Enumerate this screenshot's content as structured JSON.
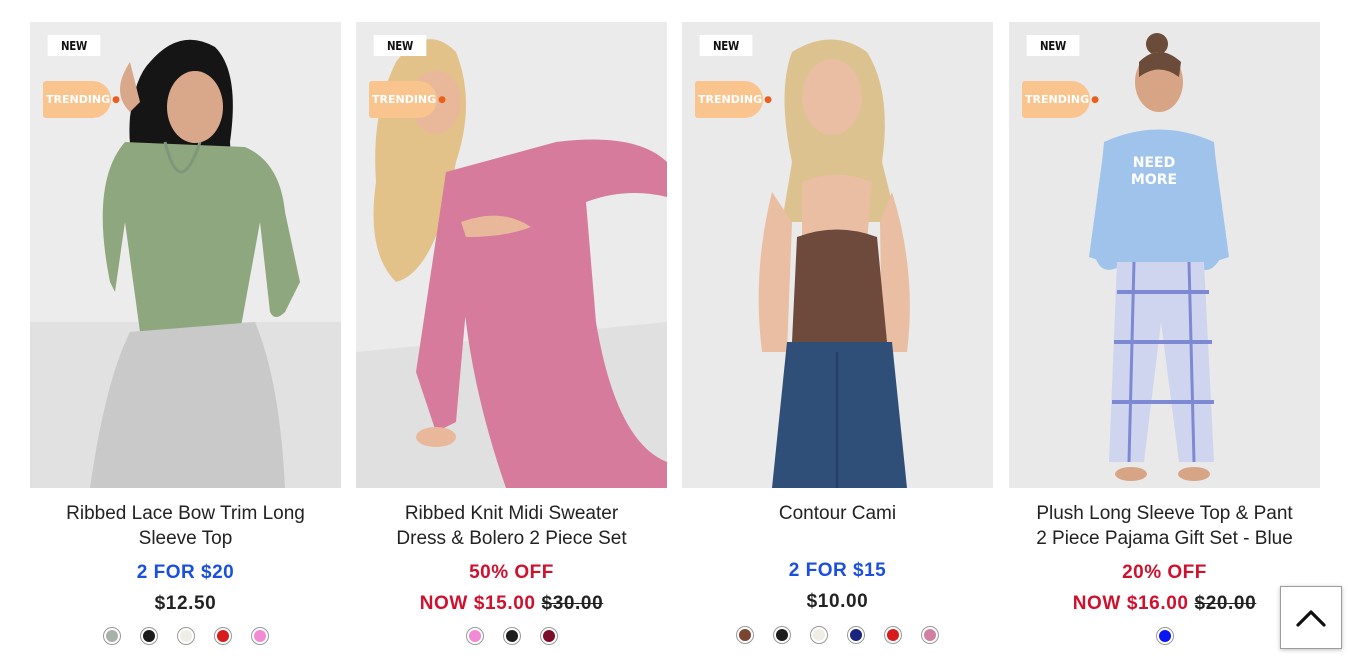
{
  "products": [
    {
      "badge_new": "NEW",
      "badge_trending": "TRENDING",
      "title_line1": "Ribbed Lace Bow Trim Long",
      "title_line2": "Sleeve Top",
      "promo": "2 FOR $20",
      "price": "$12.50",
      "swatches": [
        "#a7b3aa",
        "#1d1d1d",
        "#efeee6",
        "#d81b1b",
        "#f28ad6"
      ]
    },
    {
      "badge_new": "NEW",
      "badge_trending": "TRENDING",
      "title_line1": "Ribbed Knit Midi Sweater",
      "title_line2": "Dress & Bolero 2 Piece Set",
      "promo": "50% OFF",
      "price_now": "NOW $15.00",
      "price_was": "$30.00",
      "swatches": [
        "#f28ad6",
        "#1d1d1d",
        "#7d0e2b"
      ]
    },
    {
      "badge_new": "NEW",
      "badge_trending": "TRENDING",
      "title_line1": "Contour Cami",
      "title_line2": "",
      "promo": "2 FOR $15",
      "price": "$10.00",
      "swatches": [
        "#7a4631",
        "#1d1d1d",
        "#efeee6",
        "#1b2380",
        "#d81b1b",
        "#d17fa3"
      ]
    },
    {
      "badge_new": "NEW",
      "badge_trending": "TRENDING",
      "title_line1": "Plush Long Sleeve Top & Pant",
      "title_line2": "2 Piece Pajama Gift Set - Blue",
      "promo": "20% OFF",
      "price_now": "NOW $16.00",
      "price_was": "$20.00",
      "swatches": [
        "#0a16f2"
      ]
    }
  ],
  "colors": {
    "promo_blue": "#1a4fe0",
    "sale_red": "#d1102e",
    "trending_badge": "#f9c48d"
  },
  "icons": {
    "back_to_top": "chevron-up-icon",
    "trending": "flame-icon"
  }
}
